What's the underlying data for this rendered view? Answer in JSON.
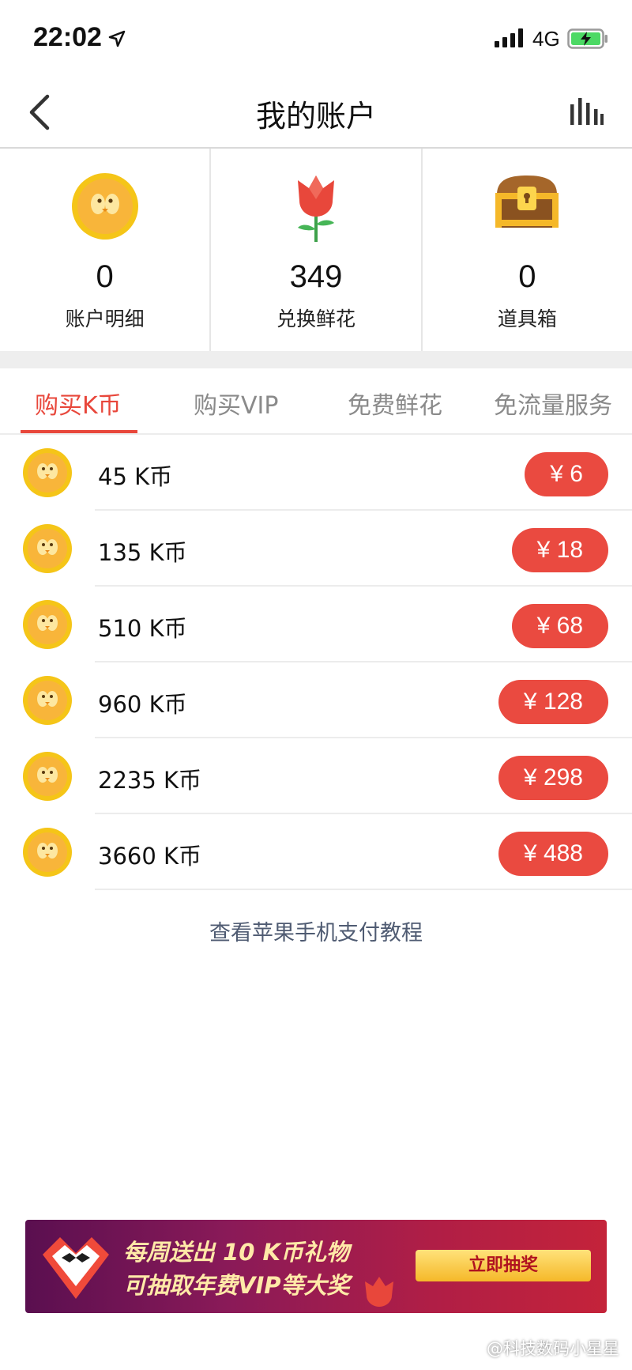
{
  "status_bar": {
    "time": "22:02",
    "network": "4G"
  },
  "nav": {
    "title": "我的账户",
    "back_icon": "chevron-left-icon",
    "stats_icon": "bar-chart-icon"
  },
  "summary": [
    {
      "value": "0",
      "label": "账户明细",
      "icon": "k-coin-icon"
    },
    {
      "value": "349",
      "label": "兑换鲜花",
      "icon": "rose-icon"
    },
    {
      "value": "0",
      "label": "道具箱",
      "icon": "treasure-chest-icon"
    }
  ],
  "tabs": [
    {
      "label": "购买K币",
      "active": true
    },
    {
      "label": "购买VIP",
      "active": false
    },
    {
      "label": "免费鲜花",
      "active": false
    },
    {
      "label": "免流量服务",
      "active": false
    }
  ],
  "packages": [
    {
      "label": "45 K币",
      "price": "¥ 6"
    },
    {
      "label": "135 K币",
      "price": "¥ 18"
    },
    {
      "label": "510 K币",
      "price": "¥ 68"
    },
    {
      "label": "960 K币",
      "price": "¥ 128"
    },
    {
      "label": "2235 K币",
      "price": "¥ 298"
    },
    {
      "label": "3660 K币",
      "price": "¥ 488"
    }
  ],
  "tutorial_link": "查看苹果手机支付教程",
  "banner": {
    "line1": "每周送出 10 K币礼物",
    "line2": "可抽取年费VIP等大奖",
    "button": "立即抽奖"
  },
  "watermark": "@科技数码小星星",
  "colors": {
    "accent": "#e8473b",
    "price_button": "#ea4a40",
    "coin": "#f5c518",
    "link": "#4f5b72"
  }
}
